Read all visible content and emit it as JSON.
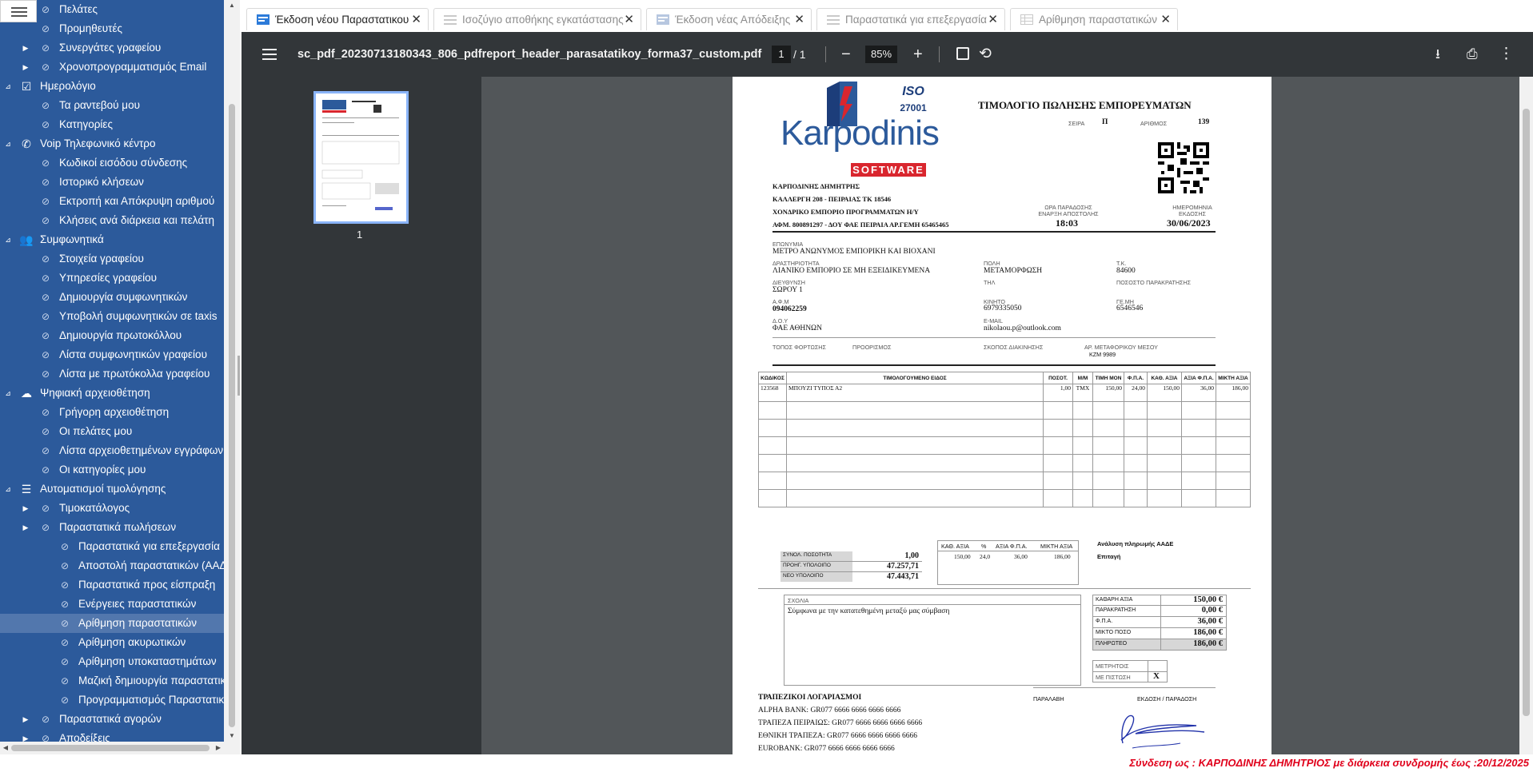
{
  "sidebar": {
    "items": [
      {
        "label": "Πελάτες",
        "level": 2,
        "expandable": false
      },
      {
        "label": "Προμηθευτές",
        "level": 2,
        "expandable": false
      },
      {
        "label": "Συνεργάτες γραφείου",
        "level": 2,
        "expandable": true
      },
      {
        "label": "Χρονοπρογραμματισμός Email",
        "level": 2,
        "expandable": true
      },
      {
        "label": "Ημερολόγιο",
        "level": 1,
        "expandable": true,
        "icon": "calendar-icon"
      },
      {
        "label": "Τα ραντεβού μου",
        "level": 2,
        "expandable": false
      },
      {
        "label": "Κατηγορίες",
        "level": 2,
        "expandable": false
      },
      {
        "label": "Voip Τηλεφωνικό κέντρο",
        "level": 1,
        "expandable": true,
        "icon": "phone-icon"
      },
      {
        "label": "Κωδικοί εισόδου σύνδεσης",
        "level": 2,
        "expandable": false
      },
      {
        "label": "Ιστορικό κλήσεων",
        "level": 2,
        "expandable": false
      },
      {
        "label": "Εκτροπή και Απόκρυψη αριθμού",
        "level": 2,
        "expandable": false
      },
      {
        "label": "Κλήσεις ανά διάρκεια και πελάτη",
        "level": 2,
        "expandable": false
      },
      {
        "label": "Συμφωνητικά",
        "level": 1,
        "expandable": true,
        "icon": "users-icon"
      },
      {
        "label": "Στοιχεία γραφείου",
        "level": 2,
        "expandable": false
      },
      {
        "label": "Υπηρεσίες γραφείου",
        "level": 2,
        "expandable": false
      },
      {
        "label": "Δημιουργία συμφωνητικών",
        "level": 2,
        "expandable": false
      },
      {
        "label": "Υποβολή συμφωνητικών σε taxis",
        "level": 2,
        "expandable": false
      },
      {
        "label": "Δημιουργία πρωτοκόλλου",
        "level": 2,
        "expandable": false
      },
      {
        "label": "Λίστα συμφωνητικών γραφείου",
        "level": 2,
        "expandable": false
      },
      {
        "label": "Λίστα με πρωτόκολλα γραφείου",
        "level": 2,
        "expandable": false
      },
      {
        "label": "Ψηφιακή αρχειοθέτηση",
        "level": 1,
        "expandable": true,
        "icon": "cloud-upload-icon"
      },
      {
        "label": "Γρήγορη αρχειοθέτηση",
        "level": 2,
        "expandable": false
      },
      {
        "label": "Οι πελάτες μου",
        "level": 2,
        "expandable": false
      },
      {
        "label": "Λίστα αρχειοθετημένων εγγράφων",
        "level": 2,
        "expandable": false
      },
      {
        "label": "Οι κατηγορίες μου",
        "level": 2,
        "expandable": false
      },
      {
        "label": "Αυτοματισμοί τιμολόγησης",
        "level": 1,
        "expandable": true,
        "icon": "list-icon"
      },
      {
        "label": "Τιμοκατάλογος",
        "level": 2,
        "expandable": true
      },
      {
        "label": "Παραστατικά πωλήσεων",
        "level": 2,
        "expandable": true
      },
      {
        "label": "Παραστατικά για επεξεργασία",
        "level": 3,
        "expandable": false
      },
      {
        "label": "Αποστολή παραστατικών (ΑΑΔΕ)",
        "level": 3,
        "expandable": false
      },
      {
        "label": "Παραστατικά προς είσπραξη",
        "level": 3,
        "expandable": false
      },
      {
        "label": "Ενέργειες παραστατικών",
        "level": 3,
        "expandable": false
      },
      {
        "label": "Αρίθμηση παραστατικών",
        "level": 3,
        "expandable": false,
        "active": true
      },
      {
        "label": "Αρίθμηση ακυρωτικών",
        "level": 3,
        "expandable": false
      },
      {
        "label": "Αρίθμηση υποκαταστημάτων",
        "level": 3,
        "expandable": false
      },
      {
        "label": "Μαζική δημιουργία παραστατικών",
        "level": 3,
        "expandable": false
      },
      {
        "label": "Προγραμματισμός Παραστατικών",
        "level": 3,
        "expandable": false
      },
      {
        "label": "Παραστατικά αγορών",
        "level": 2,
        "expandable": true
      },
      {
        "label": "Αποδείξεις",
        "level": 2,
        "expandable": true
      }
    ]
  },
  "tabs": [
    {
      "label": "Έκδοση νέου Παραστατικου",
      "active": true
    },
    {
      "label": "Ισοζύγιο αποθήκης εγκατάστασης",
      "active": false
    },
    {
      "label": "Έκδοση νέας Απόδειξης",
      "active": false
    },
    {
      "label": "Παραστατικά για επεξεργασία",
      "active": false
    },
    {
      "label": "Αρίθμηση παραστατικών",
      "active": false
    }
  ],
  "viewer": {
    "filename": "sc_pdf_20230713180343_806_pdfreport_header_parasatatikoy_forma37_custom.pdf",
    "page_current": "1",
    "page_total": "/  1",
    "zoom": "85%",
    "thumb_label": "1"
  },
  "invoice": {
    "logo_text": "Karpodinis",
    "logo_sub": "SOFTWARE",
    "iso": "ISO",
    "iso_num": "27001",
    "title": "ΤΙΜΟΛΟΓΙΟ ΠΩΛΗΣΗΣ ΕΜΠΟΡΕΥΜΑΤΩΝ",
    "series_label": "ΣΕΙΡΑ",
    "series": "Π",
    "number_label": "ΑΡΙΘΜΟΣ",
    "number": "139",
    "issuer": [
      "ΚΑΡΠΟΔΙΝΗΣ ΔΗΜΗΤΡΗΣ",
      "ΚΑΛΛΕΡΓΗ 208 - ΠΕΙΡΑΙΑΣ ΤΚ 18546",
      "ΧΟΝΔΡΙΚΟ ΕΜΠΟΡΙΟ ΠΡΟΓΡΑΜΜΑΤΩΝ Η/Υ",
      "ΑΦΜ. 800891297 - ΔΟΥ ΦΑΕ ΠΕΙΡΑΙΑ ΑΡ.ΓΕΜΗ 65465465"
    ],
    "time_label": "ΩΡΑ ΠΑΡΑΔΟΣΗΣ ΕΝΑΡΞΗ ΑΠΟΣΤΟΛΗΣ",
    "time": "18:03",
    "date_label": "ΗΜΕΡΟΜΗΝΙΑ ΕΚΔΟΣΗΣ",
    "date": "30/06/2023",
    "customer": {
      "name_label": "ΕΠΩΝΥΜΙΑ",
      "name": "ΜΕΤΡΟ ΑΝΩΝΥΜΟΣ ΕΜΠΟΡΙΚΗ ΚΑΙ ΒΙΟΧΑΝΙ",
      "activity_label": "ΔΡΑΣΤΗΡΙΟΤΗΤΑ",
      "activity": "ΛΙΑΝΙΚΟ ΕΜΠΟΡΙΟ ΣΕ ΜΗ ΕΞΕΙΔΙΚΕΥΜΕΝΑ",
      "city_label": "ΠΟΛΗ",
      "city": "ΜΕΤΑΜΟΡΦΩΣΗ",
      "tk_label": "Τ.Κ.",
      "tk": "84600",
      "address_label": "ΔΙΕΥΘΥΝΣΗ",
      "address": "ΣΩΡΟΥ 1",
      "phone_label": "ΤΗΛ",
      "withhold_label": "ΠΟΣΟΣΤΟ ΠΑΡΑΚΡΑΤΗΣΗΣ",
      "afm_label": "Α.Φ.Μ",
      "afm": "094062259",
      "mobile_label": "ΚΙΝΗΤΟ",
      "mobile": "6979335050",
      "gemi_label": "ΓΕ.ΜΗ",
      "gemi": "6546546",
      "doy_label": "Δ.Ο.Υ",
      "doy": "ΦΑΕ ΑΘΗΝΩΝ",
      "email_label": "E-MAIL",
      "email": "nikolaou.p@outlook.com"
    },
    "shipping": {
      "load_label": "ΤΟΠΟΣ ΦΟΡΤΩΣΗΣ",
      "dest_label": "ΠΡΟΟΡΙΣΜΟΣ",
      "purpose_label": "ΣΚΟΠΟΣ ΔΙΑΚΙΝΗΣΗΣ",
      "vehicle_label": "ΑΡ. ΜΕΤΑΦΟΡΙΚΟΥ ΜΕΣΟΥ",
      "vehicle": "ΚΖΜ 9989"
    },
    "columns": [
      "ΚΩΔΙΚΟΣ",
      "ΤΙΜΟΛΟΓΟΥΜΕΝΟ ΕΙΔΟΣ",
      "ΠΟΣΟΤ.",
      "Μ/Μ",
      "ΤΙΜΗ ΜΟΝ",
      "Φ.Π.Α.",
      "ΚΑΘ. ΑΞΙΑ",
      "ΑΞΙΑ Φ.Π.Α.",
      "ΜΙΚΤΗ ΑΞΙΑ"
    ],
    "rows": [
      [
        "123568",
        "ΜΠΟΥΖΙ ΤΥΠΟΣ Α2",
        "1,00",
        "ΤΜΧ",
        "150,00",
        "24,00",
        "150,00",
        "36,00",
        "186,00"
      ]
    ],
    "summary": {
      "qty_label": "ΣΥΝΟΛ. ΠΟΣΟΤΗΤΑ",
      "qty": "1,00",
      "prev_label": "ΠΡΟΗΓ. ΥΠΟΛΟΙΠΟ",
      "prev": "47.257,71",
      "new_label": "ΝΕΟ ΥΠΟΛΟΙΠΟ",
      "new": "47.443,71"
    },
    "vat_table": {
      "headers": [
        "ΚΑΘ. ΑΞΙΑ",
        "%",
        "ΑΞΙΑ Φ.Π.Α.",
        "ΜΙΚΤΗ ΑΞΙΑ"
      ],
      "values": [
        "150,00",
        "24,0",
        "36,00",
        "186,00"
      ]
    },
    "aade_label": "Ανάλυση πληρωμής ΑΑΔΕ",
    "aade_value": "Επιταγή",
    "notes_label": "ΣΧΟΛΙΑ",
    "notes": "Σύμφωνα με την κατατεθημένη μεταξύ μας σύμβαση",
    "totals": [
      {
        "label": "ΚΑΘΑΡΗ ΑΞΙΑ",
        "value": "150,00 €"
      },
      {
        "label": "ΠΑΡΑΚΡΑΤΗΣΗ",
        "value": "0,00 €"
      },
      {
        "label": "Φ.Π.Α.",
        "value": "36,00 €"
      },
      {
        "label": "ΜΙΚΤΟ ΠΟΣΟ",
        "value": "186,00 €"
      },
      {
        "label": "ΠΛΗΡΩΤΕΟ",
        "value": "186,00 €"
      }
    ],
    "pay_cash_label": "ΜΕΤΡΗΤΟΙΣ",
    "pay_credit_label": "ΜΕ ΠΙΣΤΩΣΗ",
    "pay_credit_mark": "X",
    "bank_title": "ΤΡΑΠΕΖΙΚΟΙ ΛΟΓΑΡΙΑΣΜΟΙ",
    "banks": [
      "ALPHA BANK: GR077 6666 6666 6666 6666",
      "ΤΡΑΠΕΖΑ ΠΕΙΡΑΙΩΣ: GR077 6666 6666 6666 6666",
      "ΕΘΝΙΚΗ ΤΡΑΠΕΖΑ: GR077 6666 6666 6666 6666",
      "EUROBANK: GR077 6666 6666 6666 6666"
    ],
    "receive_label": "ΠΑΡΑΛΑΒΗ",
    "issue_label": "ΕΚΔΟΣΗ / ΠΑΡΑΔΟΣΗ"
  },
  "status": {
    "text": "Σύνδεση ως : ΚΑΡΠΟΔΙΝΗΣ ΔΗΜΗΤΡΙΟΣ με διάρκεια συνδρομής έως :20/12/2025"
  },
  "colors": {
    "sidebar_bg": "#2c5a9b",
    "toolbar_bg": "#323639",
    "viewer_bg": "#525659",
    "status_red": "#e0001b",
    "thumb_border": "#8ab4f8"
  }
}
